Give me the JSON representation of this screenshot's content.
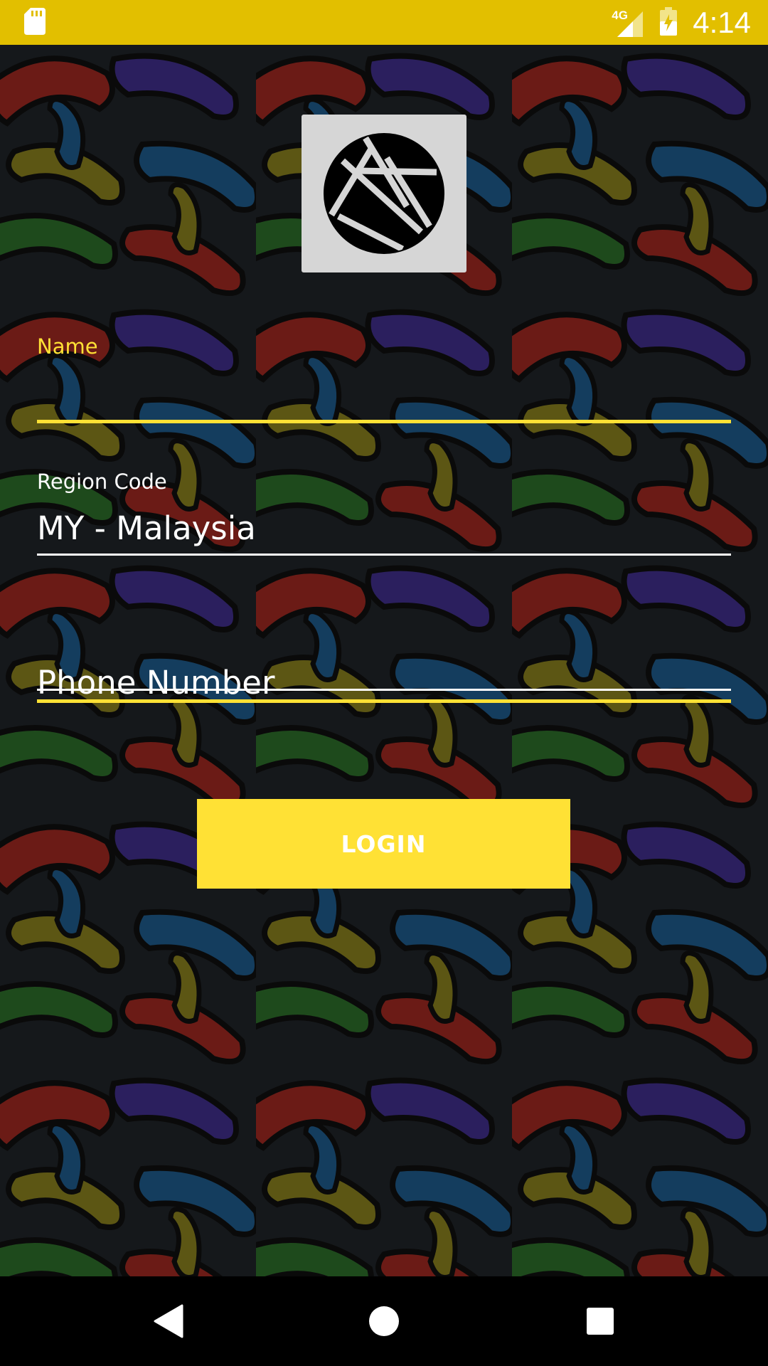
{
  "status_bar": {
    "time": "4:14",
    "network": "4G",
    "icons": [
      "sd-card-icon",
      "signal-icon",
      "battery-icon"
    ]
  },
  "logo": {
    "icon": "camera-aperture-icon"
  },
  "form": {
    "name_label": "Name",
    "name_value": "",
    "region_label": "Region Code",
    "region_value": "MY - Malaysia",
    "phone_placeholder": "Phone Number",
    "phone_value": ""
  },
  "login_button": {
    "label": "LOGIN"
  },
  "navigation": {
    "back": "back-icon",
    "home": "home-icon",
    "recents": "recents-icon"
  },
  "colors": {
    "status_bar": "#e2bf00",
    "accent": "#ffe135",
    "logo_bg": "#d6d6d6"
  }
}
